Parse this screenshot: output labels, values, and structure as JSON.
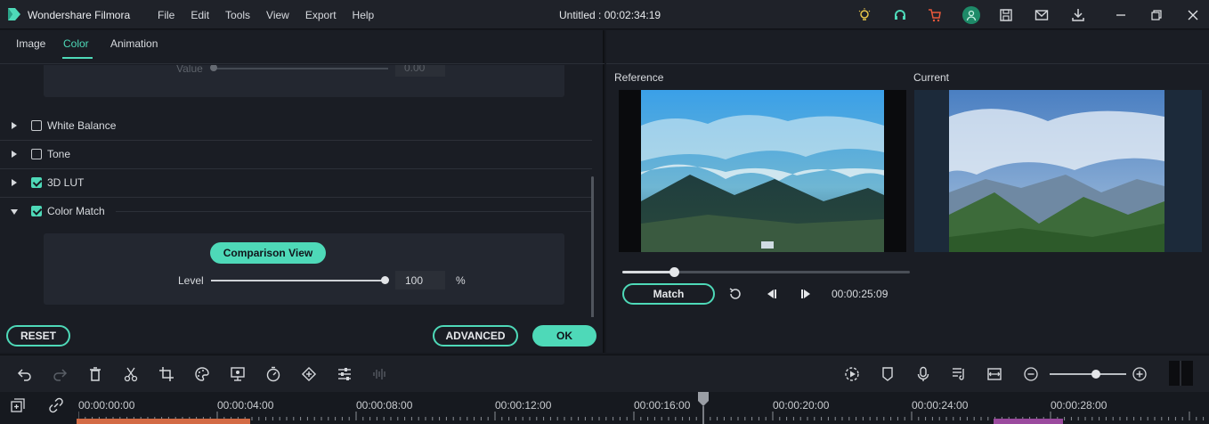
{
  "app": {
    "name": "Wondershare Filmora",
    "title": "Untitled : 00:02:34:19",
    "menu": [
      "File",
      "Edit",
      "Tools",
      "View",
      "Export",
      "Help"
    ]
  },
  "tabs": {
    "image": "Image",
    "color": "Color",
    "animation": "Animation",
    "active": "Color"
  },
  "color_settings": {
    "value_label": "Value",
    "value": "0.00",
    "sections": [
      {
        "label": "White Balance",
        "checked": false,
        "expanded": false
      },
      {
        "label": "Tone",
        "checked": false,
        "expanded": false
      },
      {
        "label": "3D LUT",
        "checked": true,
        "expanded": false
      },
      {
        "label": "Color Match",
        "checked": true,
        "expanded": true
      }
    ],
    "comparison_view": "Comparison View",
    "level_label": "Level",
    "level_value": "100",
    "level_unit": "%",
    "level_fraction": 1.0
  },
  "buttons": {
    "reset": "RESET",
    "advanced": "ADVANCED",
    "ok": "OK",
    "match": "Match"
  },
  "preview": {
    "reference_label": "Reference",
    "current_label": "Current",
    "timecode": "00:00:25:09",
    "scrub_fraction": 0.18
  },
  "timeline": {
    "ruler": [
      "00:00:00:00",
      "00:00:04:00",
      "00:00:08:00",
      "00:00:12:00",
      "00:00:16:00",
      "00:00:20:00",
      "00:00:24:00",
      "00:00:28:00"
    ]
  },
  "colors": {
    "accent": "#4ed9b8",
    "background": "#1a1d24",
    "playhead": "#9a9ea5"
  },
  "icons": {
    "top": [
      "lightbulb-icon",
      "headset-icon",
      "cart-icon",
      "account-icon",
      "save-icon",
      "mail-icon",
      "download-icon",
      "minimize-icon",
      "restore-icon",
      "close-icon"
    ],
    "toolbar": [
      "undo-icon",
      "redo-icon",
      "delete-icon",
      "cut-icon",
      "crop-icon",
      "color-icon",
      "green-screen-icon",
      "speed-icon",
      "keyframe-icon",
      "adjust-icon",
      "audio-wave-icon"
    ],
    "toolbar_right": [
      "render-icon",
      "marker-icon",
      "voiceover-icon",
      "audio-mixer-icon",
      "fit-icon",
      "zoom-out-icon",
      "zoom-in-icon"
    ]
  }
}
